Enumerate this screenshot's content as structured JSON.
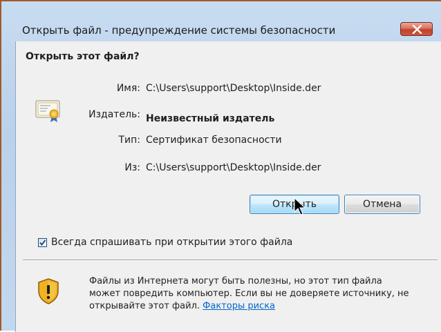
{
  "window": {
    "title": "Открыть файл - предупреждение системы безопасности",
    "close_icon": "close-icon"
  },
  "dialog": {
    "heading": "Открыть этот файл?",
    "icon": "certificate-icon",
    "fields": [
      {
        "label": "Имя:",
        "value": "C:\\Users\\support\\Desktop\\Inside.der"
      },
      {
        "label": "Издатель:",
        "value": "Неизвестный издатель"
      },
      {
        "label": "Тип:",
        "value": "Сертификат безопасности"
      },
      {
        "label": "Из:",
        "value": "C:\\Users\\support\\Desktop\\Inside.der"
      }
    ],
    "buttons": {
      "open": "Открыть",
      "cancel": "Отмена"
    },
    "always_ask": {
      "label": "Всегда спрашивать при открытии этого файла",
      "checked": true
    },
    "warning": {
      "icon": "warning-shield-icon",
      "text": "Файлы из Интернета могут быть полезны, но этот тип файла может повредить компьютер. Если вы не доверяете источнику, не открывайте этот файл.",
      "link": "Факторы риска"
    }
  }
}
